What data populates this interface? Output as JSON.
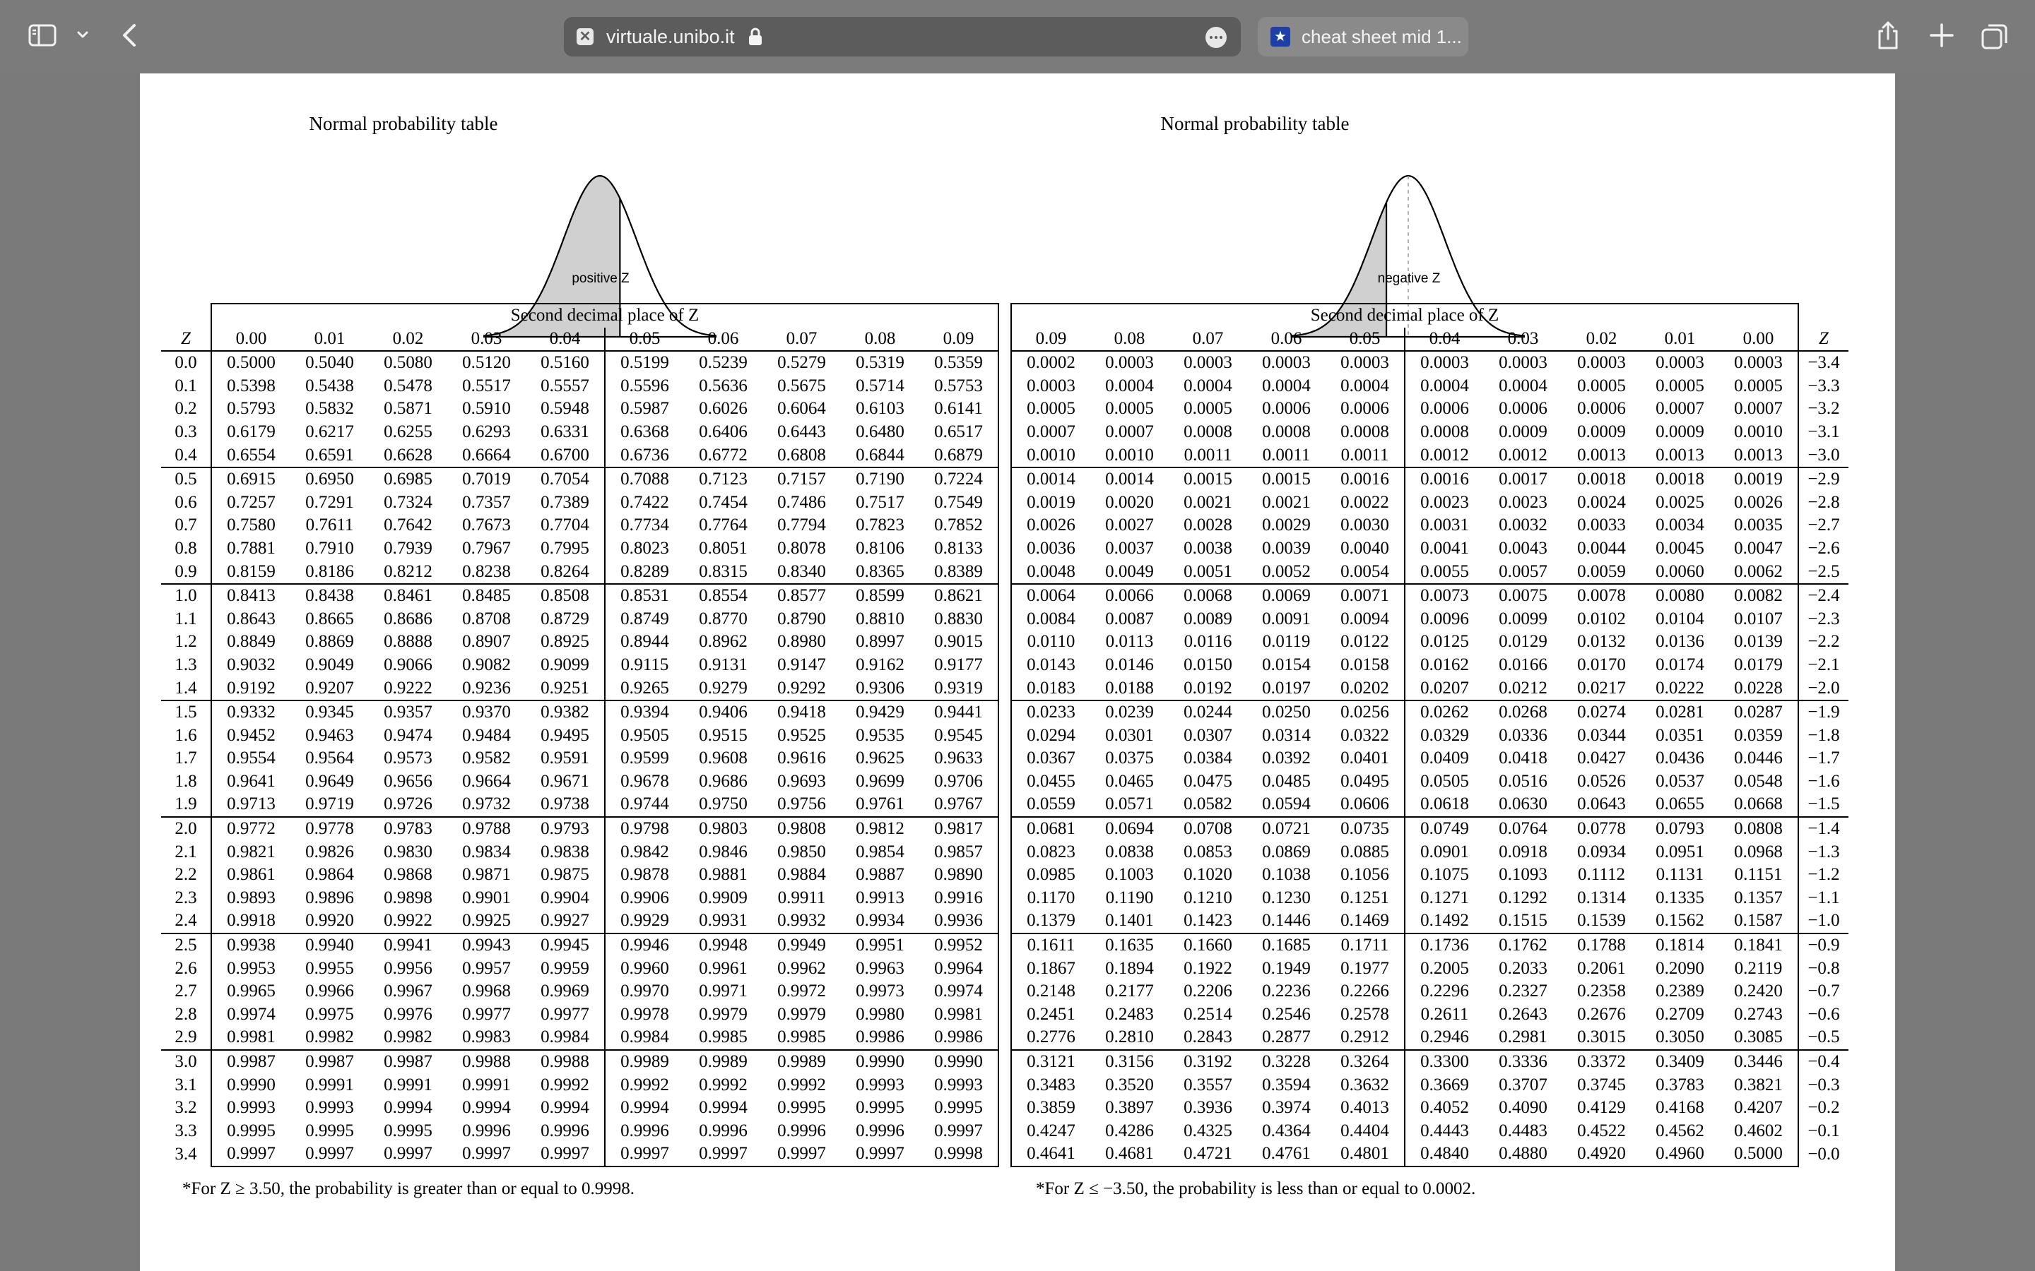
{
  "browser": {
    "url": "virtuale.unibo.it",
    "second_tab_title": "cheat sheet mid 1..."
  },
  "left_table": {
    "title": "Normal probability table",
    "curve_label": "positive Z",
    "caption": "Second decimal place of Z",
    "z_header": "Z",
    "columns": [
      "0.00",
      "0.01",
      "0.02",
      "0.03",
      "0.04",
      "0.05",
      "0.06",
      "0.07",
      "0.08",
      "0.09"
    ],
    "rows": [
      {
        "z": "0.0",
        "v": [
          "0.5000",
          "0.5040",
          "0.5080",
          "0.5120",
          "0.5160",
          "0.5199",
          "0.5239",
          "0.5279",
          "0.5319",
          "0.5359"
        ]
      },
      {
        "z": "0.1",
        "v": [
          "0.5398",
          "0.5438",
          "0.5478",
          "0.5517",
          "0.5557",
          "0.5596",
          "0.5636",
          "0.5675",
          "0.5714",
          "0.5753"
        ]
      },
      {
        "z": "0.2",
        "v": [
          "0.5793",
          "0.5832",
          "0.5871",
          "0.5910",
          "0.5948",
          "0.5987",
          "0.6026",
          "0.6064",
          "0.6103",
          "0.6141"
        ]
      },
      {
        "z": "0.3",
        "v": [
          "0.6179",
          "0.6217",
          "0.6255",
          "0.6293",
          "0.6331",
          "0.6368",
          "0.6406",
          "0.6443",
          "0.6480",
          "0.6517"
        ]
      },
      {
        "z": "0.4",
        "v": [
          "0.6554",
          "0.6591",
          "0.6628",
          "0.6664",
          "0.6700",
          "0.6736",
          "0.6772",
          "0.6808",
          "0.6844",
          "0.6879"
        ]
      },
      {
        "z": "0.5",
        "v": [
          "0.6915",
          "0.6950",
          "0.6985",
          "0.7019",
          "0.7054",
          "0.7088",
          "0.7123",
          "0.7157",
          "0.7190",
          "0.7224"
        ]
      },
      {
        "z": "0.6",
        "v": [
          "0.7257",
          "0.7291",
          "0.7324",
          "0.7357",
          "0.7389",
          "0.7422",
          "0.7454",
          "0.7486",
          "0.7517",
          "0.7549"
        ]
      },
      {
        "z": "0.7",
        "v": [
          "0.7580",
          "0.7611",
          "0.7642",
          "0.7673",
          "0.7704",
          "0.7734",
          "0.7764",
          "0.7794",
          "0.7823",
          "0.7852"
        ]
      },
      {
        "z": "0.8",
        "v": [
          "0.7881",
          "0.7910",
          "0.7939",
          "0.7967",
          "0.7995",
          "0.8023",
          "0.8051",
          "0.8078",
          "0.8106",
          "0.8133"
        ]
      },
      {
        "z": "0.9",
        "v": [
          "0.8159",
          "0.8186",
          "0.8212",
          "0.8238",
          "0.8264",
          "0.8289",
          "0.8315",
          "0.8340",
          "0.8365",
          "0.8389"
        ]
      },
      {
        "z": "1.0",
        "v": [
          "0.8413",
          "0.8438",
          "0.8461",
          "0.8485",
          "0.8508",
          "0.8531",
          "0.8554",
          "0.8577",
          "0.8599",
          "0.8621"
        ]
      },
      {
        "z": "1.1",
        "v": [
          "0.8643",
          "0.8665",
          "0.8686",
          "0.8708",
          "0.8729",
          "0.8749",
          "0.8770",
          "0.8790",
          "0.8810",
          "0.8830"
        ]
      },
      {
        "z": "1.2",
        "v": [
          "0.8849",
          "0.8869",
          "0.8888",
          "0.8907",
          "0.8925",
          "0.8944",
          "0.8962",
          "0.8980",
          "0.8997",
          "0.9015"
        ]
      },
      {
        "z": "1.3",
        "v": [
          "0.9032",
          "0.9049",
          "0.9066",
          "0.9082",
          "0.9099",
          "0.9115",
          "0.9131",
          "0.9147",
          "0.9162",
          "0.9177"
        ]
      },
      {
        "z": "1.4",
        "v": [
          "0.9192",
          "0.9207",
          "0.9222",
          "0.9236",
          "0.9251",
          "0.9265",
          "0.9279",
          "0.9292",
          "0.9306",
          "0.9319"
        ]
      },
      {
        "z": "1.5",
        "v": [
          "0.9332",
          "0.9345",
          "0.9357",
          "0.9370",
          "0.9382",
          "0.9394",
          "0.9406",
          "0.9418",
          "0.9429",
          "0.9441"
        ]
      },
      {
        "z": "1.6",
        "v": [
          "0.9452",
          "0.9463",
          "0.9474",
          "0.9484",
          "0.9495",
          "0.9505",
          "0.9515",
          "0.9525",
          "0.9535",
          "0.9545"
        ]
      },
      {
        "z": "1.7",
        "v": [
          "0.9554",
          "0.9564",
          "0.9573",
          "0.9582",
          "0.9591",
          "0.9599",
          "0.9608",
          "0.9616",
          "0.9625",
          "0.9633"
        ]
      },
      {
        "z": "1.8",
        "v": [
          "0.9641",
          "0.9649",
          "0.9656",
          "0.9664",
          "0.9671",
          "0.9678",
          "0.9686",
          "0.9693",
          "0.9699",
          "0.9706"
        ]
      },
      {
        "z": "1.9",
        "v": [
          "0.9713",
          "0.9719",
          "0.9726",
          "0.9732",
          "0.9738",
          "0.9744",
          "0.9750",
          "0.9756",
          "0.9761",
          "0.9767"
        ]
      },
      {
        "z": "2.0",
        "v": [
          "0.9772",
          "0.9778",
          "0.9783",
          "0.9788",
          "0.9793",
          "0.9798",
          "0.9803",
          "0.9808",
          "0.9812",
          "0.9817"
        ]
      },
      {
        "z": "2.1",
        "v": [
          "0.9821",
          "0.9826",
          "0.9830",
          "0.9834",
          "0.9838",
          "0.9842",
          "0.9846",
          "0.9850",
          "0.9854",
          "0.9857"
        ]
      },
      {
        "z": "2.2",
        "v": [
          "0.9861",
          "0.9864",
          "0.9868",
          "0.9871",
          "0.9875",
          "0.9878",
          "0.9881",
          "0.9884",
          "0.9887",
          "0.9890"
        ]
      },
      {
        "z": "2.3",
        "v": [
          "0.9893",
          "0.9896",
          "0.9898",
          "0.9901",
          "0.9904",
          "0.9906",
          "0.9909",
          "0.9911",
          "0.9913",
          "0.9916"
        ]
      },
      {
        "z": "2.4",
        "v": [
          "0.9918",
          "0.9920",
          "0.9922",
          "0.9925",
          "0.9927",
          "0.9929",
          "0.9931",
          "0.9932",
          "0.9934",
          "0.9936"
        ]
      },
      {
        "z": "2.5",
        "v": [
          "0.9938",
          "0.9940",
          "0.9941",
          "0.9943",
          "0.9945",
          "0.9946",
          "0.9948",
          "0.9949",
          "0.9951",
          "0.9952"
        ]
      },
      {
        "z": "2.6",
        "v": [
          "0.9953",
          "0.9955",
          "0.9956",
          "0.9957",
          "0.9959",
          "0.9960",
          "0.9961",
          "0.9962",
          "0.9963",
          "0.9964"
        ]
      },
      {
        "z": "2.7",
        "v": [
          "0.9965",
          "0.9966",
          "0.9967",
          "0.9968",
          "0.9969",
          "0.9970",
          "0.9971",
          "0.9972",
          "0.9973",
          "0.9974"
        ]
      },
      {
        "z": "2.8",
        "v": [
          "0.9974",
          "0.9975",
          "0.9976",
          "0.9977",
          "0.9977",
          "0.9978",
          "0.9979",
          "0.9979",
          "0.9980",
          "0.9981"
        ]
      },
      {
        "z": "2.9",
        "v": [
          "0.9981",
          "0.9982",
          "0.9982",
          "0.9983",
          "0.9984",
          "0.9984",
          "0.9985",
          "0.9985",
          "0.9986",
          "0.9986"
        ]
      },
      {
        "z": "3.0",
        "v": [
          "0.9987",
          "0.9987",
          "0.9987",
          "0.9988",
          "0.9988",
          "0.9989",
          "0.9989",
          "0.9989",
          "0.9990",
          "0.9990"
        ]
      },
      {
        "z": "3.1",
        "v": [
          "0.9990",
          "0.9991",
          "0.9991",
          "0.9991",
          "0.9992",
          "0.9992",
          "0.9992",
          "0.9992",
          "0.9993",
          "0.9993"
        ]
      },
      {
        "z": "3.2",
        "v": [
          "0.9993",
          "0.9993",
          "0.9994",
          "0.9994",
          "0.9994",
          "0.9994",
          "0.9994",
          "0.9995",
          "0.9995",
          "0.9995"
        ]
      },
      {
        "z": "3.3",
        "v": [
          "0.9995",
          "0.9995",
          "0.9995",
          "0.9996",
          "0.9996",
          "0.9996",
          "0.9996",
          "0.9996",
          "0.9996",
          "0.9997"
        ]
      },
      {
        "z": "3.4",
        "v": [
          "0.9997",
          "0.9997",
          "0.9997",
          "0.9997",
          "0.9997",
          "0.9997",
          "0.9997",
          "0.9997",
          "0.9997",
          "0.9998"
        ]
      }
    ],
    "footnote": "*For Z ≥ 3.50, the probability is greater than or equal to 0.9998."
  },
  "right_table": {
    "title": "Normal probability table",
    "curve_label": "negative Z",
    "caption": "Second decimal place of Z",
    "z_header": "Z",
    "columns": [
      "0.09",
      "0.08",
      "0.07",
      "0.06",
      "0.05",
      "0.04",
      "0.03",
      "0.02",
      "0.01",
      "0.00"
    ],
    "rows": [
      {
        "z": "−3.4",
        "v": [
          "0.0002",
          "0.0003",
          "0.0003",
          "0.0003",
          "0.0003",
          "0.0003",
          "0.0003",
          "0.0003",
          "0.0003",
          "0.0003"
        ]
      },
      {
        "z": "−3.3",
        "v": [
          "0.0003",
          "0.0004",
          "0.0004",
          "0.0004",
          "0.0004",
          "0.0004",
          "0.0004",
          "0.0005",
          "0.0005",
          "0.0005"
        ]
      },
      {
        "z": "−3.2",
        "v": [
          "0.0005",
          "0.0005",
          "0.0005",
          "0.0006",
          "0.0006",
          "0.0006",
          "0.0006",
          "0.0006",
          "0.0007",
          "0.0007"
        ]
      },
      {
        "z": "−3.1",
        "v": [
          "0.0007",
          "0.0007",
          "0.0008",
          "0.0008",
          "0.0008",
          "0.0008",
          "0.0009",
          "0.0009",
          "0.0009",
          "0.0010"
        ]
      },
      {
        "z": "−3.0",
        "v": [
          "0.0010",
          "0.0010",
          "0.0011",
          "0.0011",
          "0.0011",
          "0.0012",
          "0.0012",
          "0.0013",
          "0.0013",
          "0.0013"
        ]
      },
      {
        "z": "−2.9",
        "v": [
          "0.0014",
          "0.0014",
          "0.0015",
          "0.0015",
          "0.0016",
          "0.0016",
          "0.0017",
          "0.0018",
          "0.0018",
          "0.0019"
        ]
      },
      {
        "z": "−2.8",
        "v": [
          "0.0019",
          "0.0020",
          "0.0021",
          "0.0021",
          "0.0022",
          "0.0023",
          "0.0023",
          "0.0024",
          "0.0025",
          "0.0026"
        ]
      },
      {
        "z": "−2.7",
        "v": [
          "0.0026",
          "0.0027",
          "0.0028",
          "0.0029",
          "0.0030",
          "0.0031",
          "0.0032",
          "0.0033",
          "0.0034",
          "0.0035"
        ]
      },
      {
        "z": "−2.6",
        "v": [
          "0.0036",
          "0.0037",
          "0.0038",
          "0.0039",
          "0.0040",
          "0.0041",
          "0.0043",
          "0.0044",
          "0.0045",
          "0.0047"
        ]
      },
      {
        "z": "−2.5",
        "v": [
          "0.0048",
          "0.0049",
          "0.0051",
          "0.0052",
          "0.0054",
          "0.0055",
          "0.0057",
          "0.0059",
          "0.0060",
          "0.0062"
        ]
      },
      {
        "z": "−2.4",
        "v": [
          "0.0064",
          "0.0066",
          "0.0068",
          "0.0069",
          "0.0071",
          "0.0073",
          "0.0075",
          "0.0078",
          "0.0080",
          "0.0082"
        ]
      },
      {
        "z": "−2.3",
        "v": [
          "0.0084",
          "0.0087",
          "0.0089",
          "0.0091",
          "0.0094",
          "0.0096",
          "0.0099",
          "0.0102",
          "0.0104",
          "0.0107"
        ]
      },
      {
        "z": "−2.2",
        "v": [
          "0.0110",
          "0.0113",
          "0.0116",
          "0.0119",
          "0.0122",
          "0.0125",
          "0.0129",
          "0.0132",
          "0.0136",
          "0.0139"
        ]
      },
      {
        "z": "−2.1",
        "v": [
          "0.0143",
          "0.0146",
          "0.0150",
          "0.0154",
          "0.0158",
          "0.0162",
          "0.0166",
          "0.0170",
          "0.0174",
          "0.0179"
        ]
      },
      {
        "z": "−2.0",
        "v": [
          "0.0183",
          "0.0188",
          "0.0192",
          "0.0197",
          "0.0202",
          "0.0207",
          "0.0212",
          "0.0217",
          "0.0222",
          "0.0228"
        ]
      },
      {
        "z": "−1.9",
        "v": [
          "0.0233",
          "0.0239",
          "0.0244",
          "0.0250",
          "0.0256",
          "0.0262",
          "0.0268",
          "0.0274",
          "0.0281",
          "0.0287"
        ]
      },
      {
        "z": "−1.8",
        "v": [
          "0.0294",
          "0.0301",
          "0.0307",
          "0.0314",
          "0.0322",
          "0.0329",
          "0.0336",
          "0.0344",
          "0.0351",
          "0.0359"
        ]
      },
      {
        "z": "−1.7",
        "v": [
          "0.0367",
          "0.0375",
          "0.0384",
          "0.0392",
          "0.0401",
          "0.0409",
          "0.0418",
          "0.0427",
          "0.0436",
          "0.0446"
        ]
      },
      {
        "z": "−1.6",
        "v": [
          "0.0455",
          "0.0465",
          "0.0475",
          "0.0485",
          "0.0495",
          "0.0505",
          "0.0516",
          "0.0526",
          "0.0537",
          "0.0548"
        ]
      },
      {
        "z": "−1.5",
        "v": [
          "0.0559",
          "0.0571",
          "0.0582",
          "0.0594",
          "0.0606",
          "0.0618",
          "0.0630",
          "0.0643",
          "0.0655",
          "0.0668"
        ]
      },
      {
        "z": "−1.4",
        "v": [
          "0.0681",
          "0.0694",
          "0.0708",
          "0.0721",
          "0.0735",
          "0.0749",
          "0.0764",
          "0.0778",
          "0.0793",
          "0.0808"
        ]
      },
      {
        "z": "−1.3",
        "v": [
          "0.0823",
          "0.0838",
          "0.0853",
          "0.0869",
          "0.0885",
          "0.0901",
          "0.0918",
          "0.0934",
          "0.0951",
          "0.0968"
        ]
      },
      {
        "z": "−1.2",
        "v": [
          "0.0985",
          "0.1003",
          "0.1020",
          "0.1038",
          "0.1056",
          "0.1075",
          "0.1093",
          "0.1112",
          "0.1131",
          "0.1151"
        ]
      },
      {
        "z": "−1.1",
        "v": [
          "0.1170",
          "0.1190",
          "0.1210",
          "0.1230",
          "0.1251",
          "0.1271",
          "0.1292",
          "0.1314",
          "0.1335",
          "0.1357"
        ]
      },
      {
        "z": "−1.0",
        "v": [
          "0.1379",
          "0.1401",
          "0.1423",
          "0.1446",
          "0.1469",
          "0.1492",
          "0.1515",
          "0.1539",
          "0.1562",
          "0.1587"
        ]
      },
      {
        "z": "−0.9",
        "v": [
          "0.1611",
          "0.1635",
          "0.1660",
          "0.1685",
          "0.1711",
          "0.1736",
          "0.1762",
          "0.1788",
          "0.1814",
          "0.1841"
        ]
      },
      {
        "z": "−0.8",
        "v": [
          "0.1867",
          "0.1894",
          "0.1922",
          "0.1949",
          "0.1977",
          "0.2005",
          "0.2033",
          "0.2061",
          "0.2090",
          "0.2119"
        ]
      },
      {
        "z": "−0.7",
        "v": [
          "0.2148",
          "0.2177",
          "0.2206",
          "0.2236",
          "0.2266",
          "0.2296",
          "0.2327",
          "0.2358",
          "0.2389",
          "0.2420"
        ]
      },
      {
        "z": "−0.6",
        "v": [
          "0.2451",
          "0.2483",
          "0.2514",
          "0.2546",
          "0.2578",
          "0.2611",
          "0.2643",
          "0.2676",
          "0.2709",
          "0.2743"
        ]
      },
      {
        "z": "−0.5",
        "v": [
          "0.2776",
          "0.2810",
          "0.2843",
          "0.2877",
          "0.2912",
          "0.2946",
          "0.2981",
          "0.3015",
          "0.3050",
          "0.3085"
        ]
      },
      {
        "z": "−0.4",
        "v": [
          "0.3121",
          "0.3156",
          "0.3192",
          "0.3228",
          "0.3264",
          "0.3300",
          "0.3336",
          "0.3372",
          "0.3409",
          "0.3446"
        ]
      },
      {
        "z": "−0.3",
        "v": [
          "0.3483",
          "0.3520",
          "0.3557",
          "0.3594",
          "0.3632",
          "0.3669",
          "0.3707",
          "0.3745",
          "0.3783",
          "0.3821"
        ]
      },
      {
        "z": "−0.2",
        "v": [
          "0.3859",
          "0.3897",
          "0.3936",
          "0.3974",
          "0.4013",
          "0.4052",
          "0.4090",
          "0.4129",
          "0.4168",
          "0.4207"
        ]
      },
      {
        "z": "−0.1",
        "v": [
          "0.4247",
          "0.4286",
          "0.4325",
          "0.4364",
          "0.4404",
          "0.4443",
          "0.4483",
          "0.4522",
          "0.4562",
          "0.4602"
        ]
      },
      {
        "z": "−0.0",
        "v": [
          "0.4641",
          "0.4681",
          "0.4721",
          "0.4761",
          "0.4801",
          "0.4840",
          "0.4880",
          "0.4920",
          "0.4960",
          "0.5000"
        ]
      }
    ],
    "footnote": "*For Z ≤ −3.50, the probability is less than or equal to 0.0002."
  }
}
